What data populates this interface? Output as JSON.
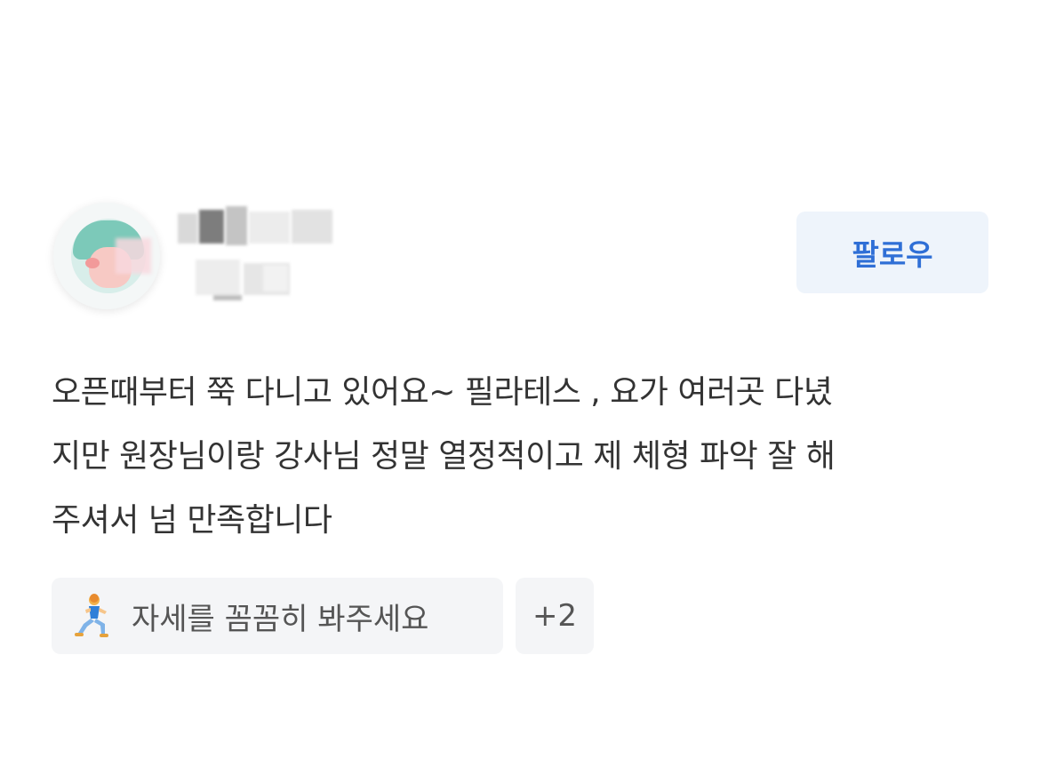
{
  "profile": {
    "avatar_icon": "avatar-icon",
    "follow_label": "팔로우"
  },
  "review": {
    "lines": [
      "오픈때부터 쭉 다니고 있어요~ 필라테스 , 요가 여러곳 다녔",
      "지만 원장님이랑 강사님 정말 열정적이고 제 체형 파악 잘 해",
      "주셔서 넘 만족합니다"
    ]
  },
  "tags": {
    "main_icon": "kneeling-person-icon",
    "main_label": "자세를 꼼꼼히 봐주세요",
    "more_label": "+2"
  },
  "colors": {
    "accent": "#2f6fd6",
    "button_bg": "#eef4fb",
    "tag_bg": "#f4f5f7"
  }
}
